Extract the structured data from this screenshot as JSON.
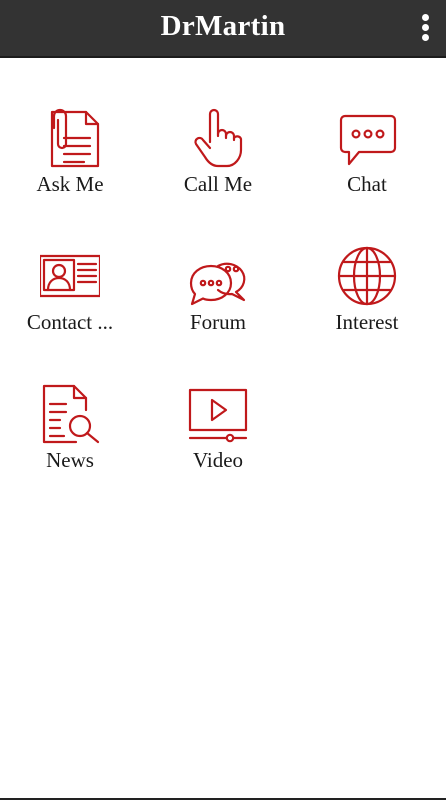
{
  "header": {
    "title": "DrMartin",
    "menu_icon": "more-vert-icon"
  },
  "colors": {
    "header_bg": "#333333",
    "accent": "#c0191b",
    "label_text": "#1a1a1a"
  },
  "menu": {
    "items": [
      {
        "label": "Ask Me",
        "icon": "document-clip-icon"
      },
      {
        "label": "Call Me",
        "icon": "hand-pointer-icon"
      },
      {
        "label": "Chat",
        "icon": "chat-bubble-icon"
      },
      {
        "label": "Contact ...",
        "icon": "id-card-icon"
      },
      {
        "label": "Forum",
        "icon": "forum-bubbles-icon"
      },
      {
        "label": "Interest",
        "icon": "globe-icon"
      },
      {
        "label": "News",
        "icon": "document-search-icon"
      },
      {
        "label": "Video",
        "icon": "video-player-icon"
      }
    ]
  }
}
